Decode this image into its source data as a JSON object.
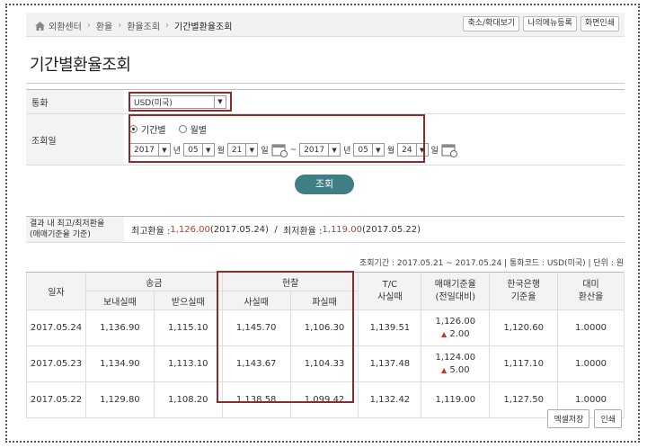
{
  "breadcrumb": [
    "외환센터",
    "환율",
    "환율조회",
    "기간별환율조회"
  ],
  "top_buttons": [
    "축소/확대보기",
    "나의메뉴등록",
    "화면인쇄"
  ],
  "page_title": "기간별환율조회",
  "form": {
    "currency_label": "통화",
    "currency_value": "USD(미국)",
    "period_label": "조회일",
    "radio_period": "기간별",
    "radio_monthly": "월별",
    "from": {
      "year": "2017",
      "month": "05",
      "day": "21"
    },
    "to": {
      "year": "2017",
      "month": "05",
      "day": "24"
    },
    "unit_year": "년",
    "unit_month": "월",
    "unit_day": "일",
    "tilde": "~"
  },
  "search_button": "조회",
  "result": {
    "label_line1": "결과 내 최고/최저환율",
    "label_line2": "(매매기준율 기준)",
    "max_label": "최고환율 : ",
    "max_value": "1,126.00",
    "max_date": "(2017.05.24)",
    "slash": "/",
    "min_label": "최저환율 : ",
    "min_value": "1,119.00",
    "min_date": "(2017.05.22)"
  },
  "info": "조회기간 : 2017.05.21 ~ 2017.05.24  |  통화코드 : USD(미국)  |  단위 : 원",
  "table": {
    "h_date": "일자",
    "h_remit": "송금",
    "h_send": "보내실때",
    "h_recv": "받으실때",
    "h_cash": "현찰",
    "h_buy": "사실때",
    "h_sell": "파실때",
    "h_tc1": "T/C",
    "h_tc2": "사실때",
    "h_base1": "매매기준율",
    "h_base2": "(전일대비)",
    "h_bok1": "한국은행",
    "h_bok2": "기준율",
    "h_usd1": "대미",
    "h_usd2": "환산율",
    "rows": [
      {
        "date": "2017.05.24",
        "send": "1,136.90",
        "recv": "1,115.10",
        "buy": "1,145.70",
        "sell": "1,106.30",
        "tc": "1,139.51",
        "base": "1,126.00",
        "change": "2.00",
        "bok": "1,120.60",
        "usd": "1.0000"
      },
      {
        "date": "2017.05.23",
        "send": "1,134.90",
        "recv": "1,113.10",
        "buy": "1,143.67",
        "sell": "1,104.33",
        "tc": "1,137.48",
        "base": "1,124.00",
        "change": "5.00",
        "bok": "1,117.10",
        "usd": "1.0000"
      },
      {
        "date": "2017.05.22",
        "send": "1,129.80",
        "recv": "1,108.20",
        "buy": "1,138.58",
        "sell": "1,099.42",
        "tc": "1,132.42",
        "base": "1,119.00",
        "change": "",
        "bok": "1,127.50",
        "usd": "1.0000"
      }
    ]
  },
  "bottom_buttons": [
    "엑셀저장",
    "인쇄"
  ],
  "colors": {
    "accent": "#3f7e84",
    "highlight_box": "#8b2b2b",
    "up": "#c0392b"
  }
}
